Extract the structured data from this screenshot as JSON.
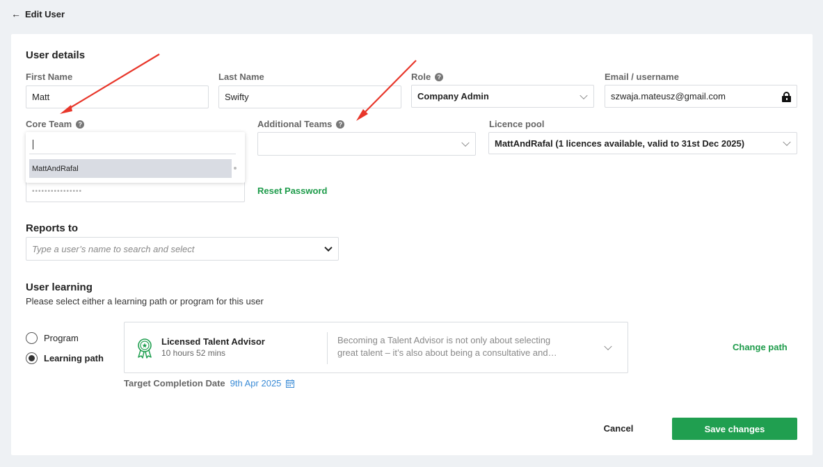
{
  "header": {
    "back_icon": "arrow-left-icon",
    "title": "Edit User"
  },
  "user_details": {
    "section_title": "User details",
    "first_name": {
      "label": "First Name",
      "value": "Matt"
    },
    "last_name": {
      "label": "Last Name",
      "value": "Swifty"
    },
    "role": {
      "label": "Role",
      "help": "?",
      "value": "Company Admin"
    },
    "email": {
      "label": "Email / username",
      "value": "szwaja.mateusz@gmail.com",
      "icon": "lock-icon"
    },
    "core_team": {
      "label": "Core Team",
      "help": "?",
      "search_value": "",
      "options": [
        "MattAndRafal"
      ]
    },
    "additional_teams": {
      "label": "Additional Teams",
      "help": "?",
      "value": ""
    },
    "licence_pool": {
      "label": "Licence pool",
      "value": "MattAndRafal (1 licences available, valid to 31st Dec 2025)"
    },
    "password": {
      "value": "••••••••••••••••"
    },
    "reset_password": "Reset Password"
  },
  "reports_to": {
    "section_title": "Reports to",
    "placeholder": "Type a user’s name to search and select"
  },
  "user_learning": {
    "section_title": "User learning",
    "subtitle": "Please select either a learning path or program for this user",
    "options": [
      {
        "label": "Program",
        "checked": false
      },
      {
        "label": "Learning path",
        "checked": true
      }
    ],
    "path": {
      "icon": "award-ribbon-icon",
      "name": "Licensed Talent Advisor",
      "duration": "10 hours 52 mins",
      "description_line1": "Becoming a Talent Advisor is not only about selecting",
      "description_line2": "great talent – it’s also about being a consultative and…"
    },
    "change_path": "Change path",
    "target_completion_label": "Target Completion Date",
    "target_completion_value": "9th Apr 2025",
    "calendar_icon": "calendar-icon"
  },
  "actions": {
    "cancel": "Cancel",
    "save": "Save changes"
  },
  "colors": {
    "accent": "#209f50",
    "link": "#3a8bd6",
    "annotation": "#e8362a"
  }
}
